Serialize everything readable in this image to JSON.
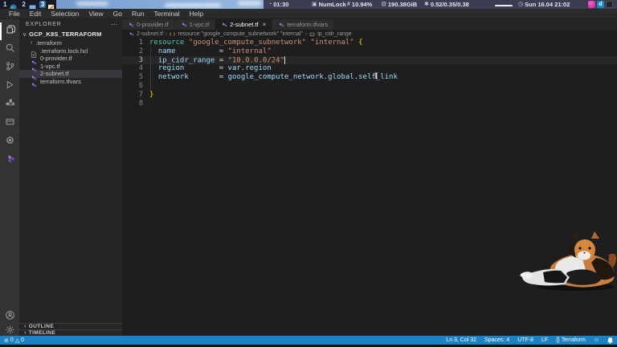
{
  "colors": {
    "status_bar_blue": "#1b80c4",
    "terraform_purple": "#7b42bc",
    "keyword_green": "#4ec9b0",
    "string_orange": "#ce9178",
    "property_blue": "#9cdcfe",
    "brace_gold": "#ffd700"
  },
  "desktop_bar": {
    "workspaces": [
      {
        "num": "1",
        "icon": "globe-icon",
        "active": false
      },
      {
        "num": "2",
        "icon": "monitor-icon",
        "active": false
      },
      {
        "num": "3",
        "icon": "editor-icon",
        "active": true
      }
    ],
    "clock": "01:30",
    "numlock": "NumLock",
    "cpu": "10.94%",
    "disk": "190.38GiB",
    "load": "0.52/0.35/0.38",
    "date": "Sun 16.04 21:02",
    "tray_icons": [
      "pink-app-icon",
      "docker-icon",
      "terminal-icon"
    ]
  },
  "menu_bar": {
    "items": [
      "File",
      "Edit",
      "Selection",
      "View",
      "Go",
      "Run",
      "Terminal",
      "Help"
    ]
  },
  "activity_bar": {
    "top_icons": [
      "files-icon",
      "search-icon",
      "source-control-icon",
      "run-debug-icon",
      "extensions-icon",
      "remote-icon",
      "circle-icon",
      "terraform-icon"
    ],
    "bottom_icons": [
      "account-icon",
      "settings-gear-icon"
    ]
  },
  "explorer": {
    "title": "EXPLORER",
    "root": "GCP_K8S_TERRAFORM",
    "items": [
      {
        "label": ".terraform",
        "kind": "folder",
        "selected": false
      },
      {
        "label": ".terraform.lock.hcl",
        "kind": "file",
        "selected": false
      },
      {
        "label": "0-provider.tf",
        "kind": "terraform",
        "selected": false
      },
      {
        "label": "1-vpc.tf",
        "kind": "terraform",
        "selected": false
      },
      {
        "label": "2-subnet.tf",
        "kind": "terraform",
        "selected": true
      },
      {
        "label": "terraform.tfvars",
        "kind": "terraform",
        "selected": false
      }
    ],
    "sections": [
      "OUTLINE",
      "TIMELINE"
    ]
  },
  "tabs": [
    {
      "label": "0-provider.tf",
      "active": false
    },
    {
      "label": "1-vpc.tf",
      "active": false
    },
    {
      "label": "2-subnet.tf",
      "active": true,
      "close": "×"
    },
    {
      "label": "terraform.tfvars",
      "active": false
    }
  ],
  "breadcrumb": [
    "2-subnet.tf",
    "resource \"google_compute_subnetwork\" \"internal\"",
    "ip_cidr_range"
  ],
  "editor": {
    "lines": [
      {
        "num": "1",
        "current": false,
        "tokens": [
          [
            "resource",
            "kw"
          ],
          [
            " ",
            "pl"
          ],
          [
            "\"google_compute_subnetwork\"",
            "str"
          ],
          [
            " ",
            "pl"
          ],
          [
            "\"internal\"",
            "str"
          ],
          [
            " ",
            "pl"
          ],
          [
            "{",
            "brace"
          ]
        ]
      },
      {
        "num": "2",
        "current": false,
        "tokens": [
          [
            "  ",
            "pl"
          ],
          [
            "name",
            "prop"
          ],
          [
            "          = ",
            "pl"
          ],
          [
            "\"internal\"",
            "str"
          ]
        ]
      },
      {
        "num": "3",
        "current": true,
        "tokens": [
          [
            "  ",
            "pl"
          ],
          [
            "ip_cidr_range",
            "prop"
          ],
          [
            " = ",
            "pl"
          ],
          [
            "\"10.0.0.0/24\"",
            "str"
          ],
          [
            "",
            "cursor"
          ]
        ]
      },
      {
        "num": "4",
        "current": false,
        "tokens": [
          [
            "  ",
            "pl"
          ],
          [
            "region",
            "prop"
          ],
          [
            "        = ",
            "pl"
          ],
          [
            "var.region",
            "val"
          ]
        ]
      },
      {
        "num": "5",
        "current": false,
        "tokens": [
          [
            "  ",
            "pl"
          ],
          [
            "network",
            "prop"
          ],
          [
            "       = ",
            "pl"
          ],
          [
            "google_compute_network.global.self_link",
            "val"
          ]
        ]
      },
      {
        "num": "6",
        "current": false,
        "tokens": []
      },
      {
        "num": "7",
        "current": false,
        "tokens": [
          [
            "}",
            "brace"
          ]
        ]
      },
      {
        "num": "8",
        "current": false,
        "tokens": []
      }
    ]
  },
  "status_bar": {
    "errors": "0",
    "warnings": "0",
    "line_col": "Ln 3, Col 32",
    "spaces": "Spaces: 4",
    "encoding": "UTF-8",
    "eol": "LF",
    "language": "Terraform"
  }
}
